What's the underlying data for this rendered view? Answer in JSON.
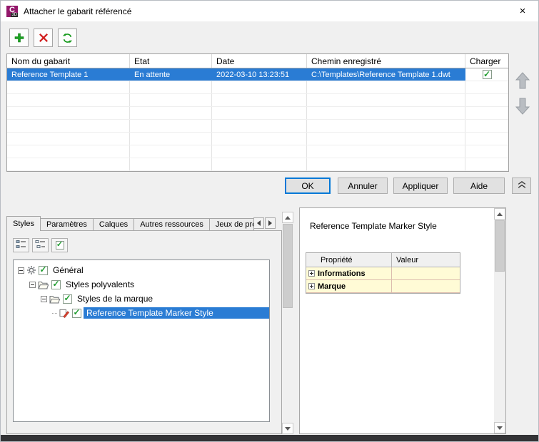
{
  "colors": {
    "selection_blue": "#2a7cd4",
    "focus_blue": "#0078d7",
    "app_icon_magenta": "#93176b",
    "check_green": "#1f9d2f",
    "add_green": "#1ca222",
    "delete_red": "#d11f1f",
    "grid_row_yellow": "#fffbd6"
  },
  "icons": {
    "close": "×",
    "check": "✓"
  },
  "window": {
    "title": "Attacher le gabarit référencé",
    "icon_letter": "C",
    "icon_sub": "3D"
  },
  "template_table": {
    "columns": [
      "Nom du gabarit",
      "Etat",
      "Date",
      "Chemin enregistré",
      "Charger"
    ],
    "rows": [
      {
        "name": "Reference Template 1",
        "state": "En attente",
        "date": "2022-03-10 13:23:51",
        "path": "C:\\Templates\\Reference Template 1.dwt",
        "load": true,
        "selected": true
      }
    ],
    "empty_row_count": 7
  },
  "action_buttons": {
    "ok": "OK",
    "cancel": "Annuler",
    "apply": "Appliquer",
    "help": "Aide"
  },
  "left_panel": {
    "tabs": [
      {
        "label": "Styles",
        "active": true
      },
      {
        "label": "Paramètres",
        "active": false
      },
      {
        "label": "Calques",
        "active": false
      },
      {
        "label": "Autres ressources",
        "active": false
      },
      {
        "label": "Jeux de pro",
        "active": false
      }
    ],
    "tree": [
      {
        "label": "Général",
        "icon": "gear",
        "checked": true,
        "level": 0
      },
      {
        "label": "Styles polyvalents",
        "icon": "folder",
        "checked": true,
        "level": 1
      },
      {
        "label": "Styles de la marque",
        "icon": "folder",
        "checked": true,
        "level": 2
      },
      {
        "label": "Reference Template Marker Style",
        "icon": "marker-style",
        "checked": true,
        "level": 3,
        "selected": true
      }
    ]
  },
  "right_panel": {
    "title": "Reference Template Marker Style",
    "grid": {
      "columns": [
        "Propriété",
        "Valeur"
      ],
      "rows": [
        {
          "property": "Informations",
          "value": ""
        },
        {
          "property": "Marque",
          "value": ""
        }
      ]
    }
  }
}
